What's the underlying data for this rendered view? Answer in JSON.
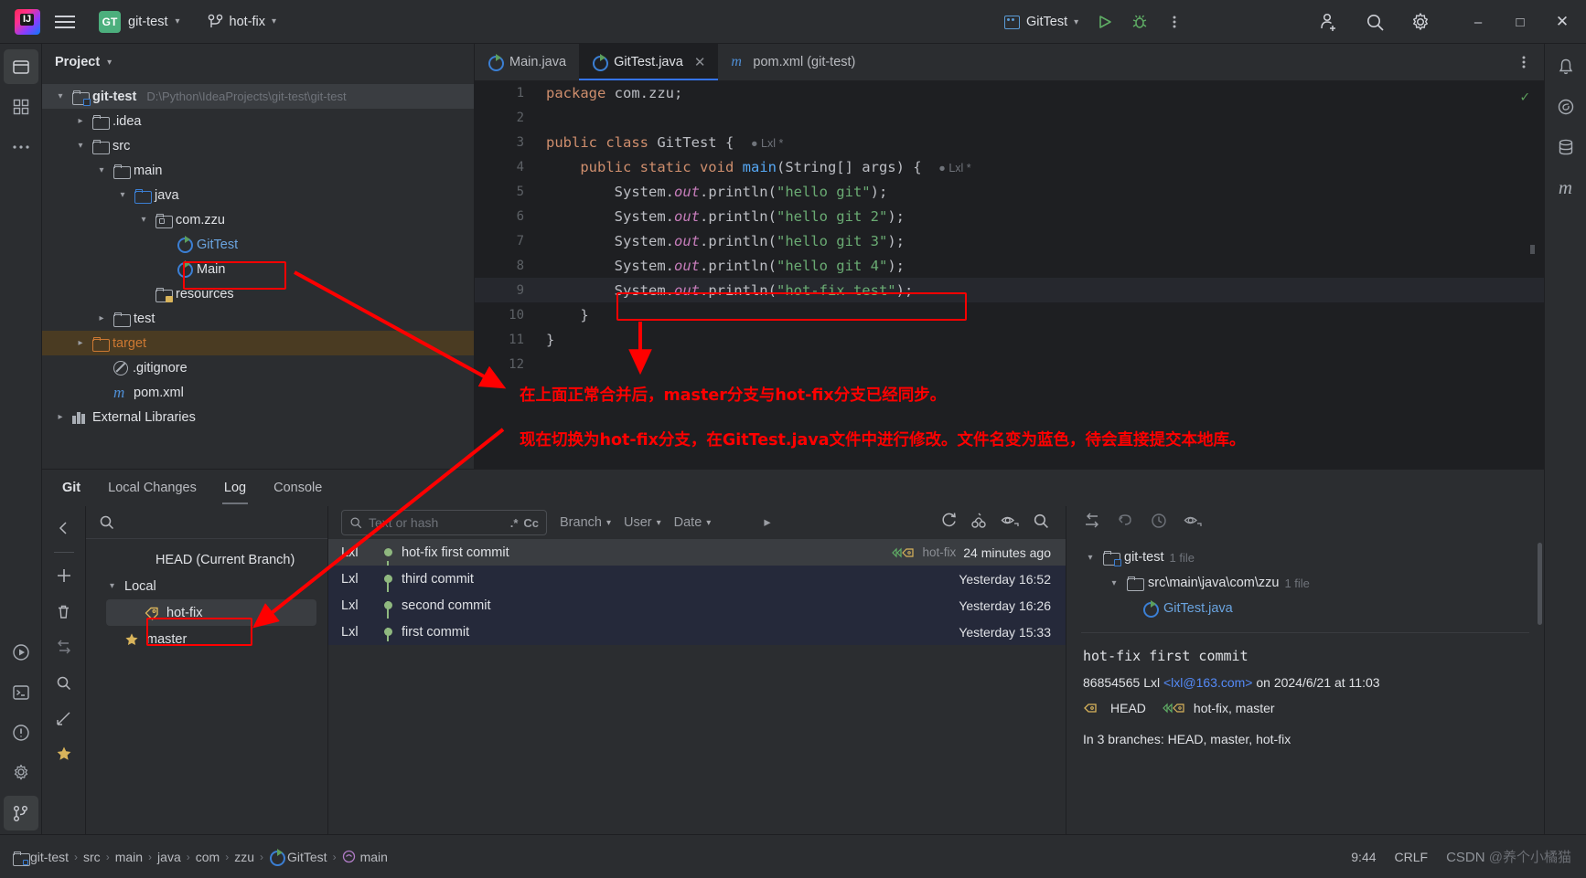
{
  "titlebar": {
    "menu_icon": "hamburger-icon",
    "project_badge": "GT",
    "project_name": "git-test",
    "branch_icon": "git-branch-icon",
    "branch_name": "hot-fix",
    "run_config": "GitTest",
    "run_icon": "run-icon",
    "debug_icon": "debug-icon",
    "more_icon": "more-vertical-icon",
    "account_icon": "add-user-icon",
    "search_icon": "search-icon",
    "settings_icon": "gear-icon",
    "minimize": "–",
    "maximize": "□",
    "close": "✕"
  },
  "project": {
    "title": "Project",
    "tree": [
      {
        "label": "git-test",
        "path": "D:\\Python\\IdeaProjects\\git-test\\git-test",
        "indent": 0,
        "arrow": "down",
        "icon": "module-folder-icon",
        "bold": true,
        "selected": true
      },
      {
        "label": ".idea",
        "indent": 1,
        "arrow": "right",
        "icon": "folder-icon"
      },
      {
        "label": "src",
        "indent": 1,
        "arrow": "down",
        "icon": "folder-icon"
      },
      {
        "label": "main",
        "indent": 2,
        "arrow": "down",
        "icon": "folder-icon"
      },
      {
        "label": "java",
        "indent": 3,
        "arrow": "down",
        "icon": "source-folder-icon"
      },
      {
        "label": "com.zzu",
        "indent": 4,
        "arrow": "down",
        "icon": "package-icon"
      },
      {
        "label": "GitTest",
        "indent": 5,
        "arrow": "none",
        "icon": "java-class-icon",
        "color": "blue",
        "highlight": true
      },
      {
        "label": "Main",
        "indent": 5,
        "arrow": "none",
        "icon": "java-class-icon"
      },
      {
        "label": "resources",
        "indent": 4,
        "arrow": "none",
        "icon": "resources-folder-icon"
      },
      {
        "label": "test",
        "indent": 2,
        "arrow": "right",
        "icon": "folder-icon"
      },
      {
        "label": "target",
        "indent": 1,
        "arrow": "right",
        "icon": "excluded-folder-icon",
        "color": "orange",
        "rowstyle": "target"
      },
      {
        "label": ".gitignore",
        "indent": 2,
        "arrow": "none",
        "icon": "gitignore-icon"
      },
      {
        "label": "pom.xml",
        "indent": 2,
        "arrow": "none",
        "icon": "maven-icon"
      },
      {
        "label": "External Libraries",
        "indent": 0,
        "arrow": "right",
        "icon": "external-libraries-icon"
      }
    ]
  },
  "editor": {
    "tabs": [
      {
        "label": "Main.java",
        "icon": "java-class-icon",
        "active": false,
        "closable": false
      },
      {
        "label": "GitTest.java",
        "icon": "java-class-icon",
        "active": true,
        "closable": true,
        "close": "✕"
      },
      {
        "label": "pom.xml (git-test)",
        "icon": "maven-icon",
        "active": false,
        "closable": false
      }
    ],
    "more_icon": "more-vertical-icon",
    "inspection_status": "✓",
    "lines": [
      {
        "n": "1",
        "marker": "",
        "code": "package com.zzu;"
      },
      {
        "n": "2",
        "marker": "",
        "code": ""
      },
      {
        "n": "3",
        "marker": "run",
        "code": "public class GitTest {",
        "author": "Lxl *"
      },
      {
        "n": "4",
        "marker": "run",
        "code": "    public static void main(String[] args) {",
        "author": "Lxl *"
      },
      {
        "n": "5",
        "marker": "",
        "code": "        System.out.println(\"hello git\");"
      },
      {
        "n": "6",
        "marker": "",
        "code": "        System.out.println(\"hello git 2\");"
      },
      {
        "n": "7",
        "marker": "",
        "code": "        System.out.println(\"hello git 3\");"
      },
      {
        "n": "8",
        "marker": "",
        "code": "        System.out.println(\"hello git 4\");"
      },
      {
        "n": "9",
        "marker": "",
        "code": "        System.out.println(\"hot-fix test\");",
        "current": true,
        "highlight": true
      },
      {
        "n": "10",
        "marker": "",
        "code": "    }"
      },
      {
        "n": "11",
        "marker": "",
        "code": "}"
      },
      {
        "n": "12",
        "marker": "",
        "code": ""
      }
    ]
  },
  "annotations": {
    "line1": "在上面正常合并后，master分支与hot-fix分支已经同步。",
    "line2": "现在切换为hot-fix分支，在GitTest.java文件中进行修改。文件名变为蓝色，待会直接提交本地库。",
    "color": "#ff0000"
  },
  "git_window": {
    "tabs": [
      {
        "label": "Git",
        "bold": true
      },
      {
        "label": "Local Changes"
      },
      {
        "label": "Log",
        "selected": true
      },
      {
        "label": "Console"
      }
    ],
    "rail_icons": [
      "collapse-left-icon",
      "add-icon",
      "delete-icon",
      "fetch-icon",
      "search-icon",
      "branch-graph-icon",
      "favorite-star-icon"
    ],
    "branch_panel": {
      "search_icon": "search-icon",
      "rows": [
        {
          "label": "HEAD (Current Branch)",
          "arrow": "none",
          "icon": "none",
          "indent": 1
        },
        {
          "label": "Local",
          "arrow": "down",
          "icon": "none",
          "indent": 0
        },
        {
          "label": "hot-fix",
          "arrow": "none",
          "icon": "branch-tag-icon",
          "indent": 2,
          "selected": true,
          "highlight": true
        },
        {
          "label": "master",
          "arrow": "none",
          "icon": "star-icon",
          "indent": 2
        }
      ]
    },
    "log_toolbar": {
      "search_icon": "search-filter-icon",
      "search_placeholder": "Text or hash",
      "regex_label": ".*",
      "case_label": "Cc",
      "filters": [
        "Branch",
        "User",
        "Date"
      ],
      "expand_icon": "chevron-right-icon",
      "refresh_icon": "refresh-icon",
      "cherry_pick_icon": "cherry-pick-icon",
      "eye_icon": "eye-icon",
      "search_icon2": "search-icon"
    },
    "commits": [
      {
        "user": "Lxl",
        "message": "hot-fix first commit",
        "tag": "hot-fix",
        "tag_icon": "branch-label-icon",
        "date": "24 minutes ago",
        "selected": true
      },
      {
        "user": "Lxl",
        "message": "third commit",
        "tag": "",
        "date": "Yesterday 16:52"
      },
      {
        "user": "Lxl",
        "message": "second commit",
        "tag": "",
        "date": "Yesterday 16:26"
      },
      {
        "user": "Lxl",
        "message": "first commit",
        "tag": "",
        "date": "Yesterday 15:33"
      }
    ],
    "details": {
      "toolbar_icons": [
        "expand-all-icon",
        "revert-icon",
        "history-icon",
        "eye-icon"
      ],
      "file_tree": [
        {
          "label": "git-test",
          "count": "1 file",
          "icon": "module-folder-icon",
          "arrow": "down",
          "indent": 0
        },
        {
          "label": "src\\main\\java\\com\\zzu",
          "count": "1 file",
          "icon": "folder-icon",
          "arrow": "down",
          "indent": 1
        },
        {
          "label": "GitTest.java",
          "count": "",
          "icon": "java-class-icon",
          "arrow": "none",
          "indent": 2,
          "color": "blue"
        }
      ],
      "commit_message": "hot-fix first commit",
      "hash": "86854565",
      "author": "Lxl",
      "email": "<lxl@163.com>",
      "on_text": "on 2024/6/21 at 11:03",
      "refs": [
        {
          "label": "HEAD",
          "icon": "head-label-icon"
        },
        {
          "label": "hot-fix, master",
          "icon": "branch-label-icon"
        }
      ],
      "branches_text": "In 3 branches: HEAD, master, hot-fix"
    }
  },
  "statusbar": {
    "breadcrumb": [
      {
        "label": "git-test",
        "icon": "module-icon"
      },
      {
        "label": "src",
        "icon": "none"
      },
      {
        "label": "main",
        "icon": "none"
      },
      {
        "label": "java",
        "icon": "none"
      },
      {
        "label": "com",
        "icon": "none"
      },
      {
        "label": "zzu",
        "icon": "none"
      },
      {
        "label": "GitTest",
        "icon": "java-class-icon"
      },
      {
        "label": "main",
        "icon": "method-icon"
      }
    ],
    "separator": "›",
    "caret_position": "9:44",
    "line_separator": "CRLF",
    "watermark_prefix": "CSDN",
    "watermark_user": "@养个小橘猫"
  },
  "right_rail_icons": [
    "notifications-icon",
    "ai-assistant-icon",
    "database-icon",
    "maven-icon"
  ],
  "left_rail_icons": [
    "project-icon",
    "structure-icon",
    "more-icon",
    "run-icon",
    "terminal-icon",
    "git-icon",
    "problems-icon",
    "settings-icon"
  ],
  "colors": {
    "accent": "#3574f0",
    "annotation": "#ff0000",
    "selection": "#3a3d41",
    "background": "#2b2d30",
    "editor_bg": "#1e1f22"
  }
}
